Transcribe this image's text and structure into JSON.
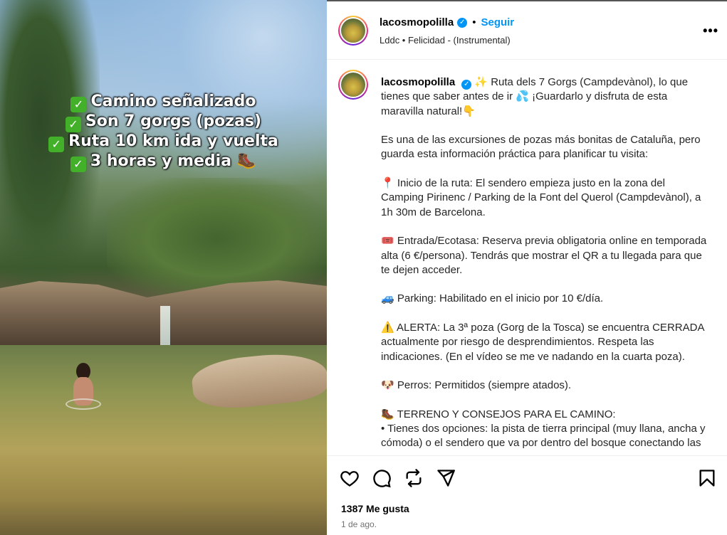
{
  "media": {
    "overlay_lines": [
      "Camino señalizado",
      "Son 7 gorgs (pozas)",
      "Ruta 10 km ida y vuelta",
      "3 horas y media"
    ],
    "check_glyph": "✓",
    "boot_glyph": "🥾"
  },
  "header": {
    "username": "lacosmopolilla",
    "verified_glyph": "✓",
    "separator": "•",
    "follow_label": "Seguir",
    "audio": "Lddc • Felicidad - (Instrumental)",
    "more_label": "•••"
  },
  "caption": {
    "username": "lacosmopolilla",
    "verified_glyph": "✓",
    "body": "✨ Ruta dels 7 Gorgs (Campdevànol), lo que tienes que saber antes de ir 💦 ¡Guardarlo y disfruta de esta maravilla natural!👇\n\nEs una de las excursiones de pozas más bonitas de Cataluña, pero guarda esta información práctica para planificar tu visita:\n\n📍 Inicio de la ruta: El sendero empieza justo en la zona del Camping Pirinenc / Parking de la Font del Querol (Campdevànol), a 1h 30m de Barcelona.\n\n🎟️ Entrada/Ecotasa: Reserva previa obligatoria online en temporada alta (6 €/persona). Tendrás que mostrar el QR a tu llegada para que te dejen acceder.\n\n🚙 Parking: Habilitado en el inicio por 10 €/día.\n\n⚠️ ALERTA: La 3ª poza (Gorg de la Tosca) se encuentra CERRADA actualmente por riesgo de desprendimientos. Respeta las indicaciones. (En el vídeo se me ve nadando en la cuarta poza).\n\n🐶 Perros: Permitidos (siempre atados).\n\n🥾 TERRENO Y CONSEJOS PARA EL CAMINO:\n• Tienes dos opciones: la pista de tierra principal (muy llana, ancha y cómoda) o el sendero que va por dentro del bosque conectando las pozas."
  },
  "footer": {
    "likes": "1387 Me gusta",
    "date": "1 de ago."
  },
  "icons": [
    "heart-icon",
    "comment-icon",
    "repost-icon",
    "share-icon",
    "save-icon"
  ],
  "colors": {
    "accent": "#0095f6",
    "check_green": "#43b02a"
  }
}
